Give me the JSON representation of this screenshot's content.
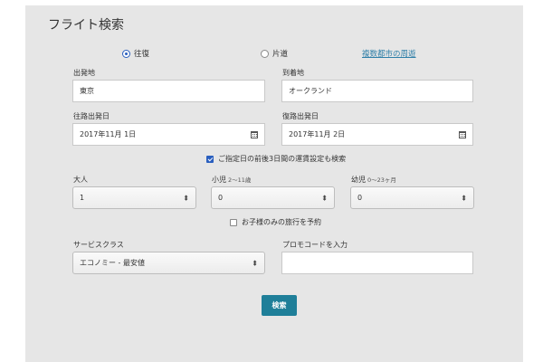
{
  "form": {
    "title": "フライト検索",
    "trip_type": {
      "round_trip": "往復",
      "one_way": "片道",
      "multi_city": "複数都市の周遊",
      "selected": "round_trip"
    },
    "origin": {
      "label": "出発地",
      "value": "東京"
    },
    "destination": {
      "label": "到着地",
      "value": "オークランド"
    },
    "depart_date": {
      "label": "往路出発日",
      "value": "2017年11月 1日"
    },
    "return_date": {
      "label": "復路出発日",
      "value": "2017年11月 2日"
    },
    "flexible_dates": {
      "label": "ご指定日の前後3日間の運賃設定も検索",
      "checked": true
    },
    "adults": {
      "label": "大人",
      "value": "1"
    },
    "children": {
      "label": "小児",
      "sublabel": "2〜11歳",
      "value": "0"
    },
    "infants": {
      "label": "幼児",
      "sublabel": "0〜23ヶ月",
      "value": "0"
    },
    "unaccompanied_minor": {
      "label": "お子様のみの旅行を予約",
      "checked": false
    },
    "service_class": {
      "label": "サービスクラス",
      "value": "エコノミー - 最安値"
    },
    "promo_code": {
      "label": "プロモコードを入力",
      "value": ""
    },
    "search_button": "検索"
  },
  "icons": {
    "calendar": "calendar-icon",
    "select_arrows": "⬍"
  },
  "colors": {
    "panel_bg": "#e6e6e6",
    "accent_blue": "#2a5fbf",
    "link": "#2f7fa8",
    "button": "#1f7f99"
  }
}
